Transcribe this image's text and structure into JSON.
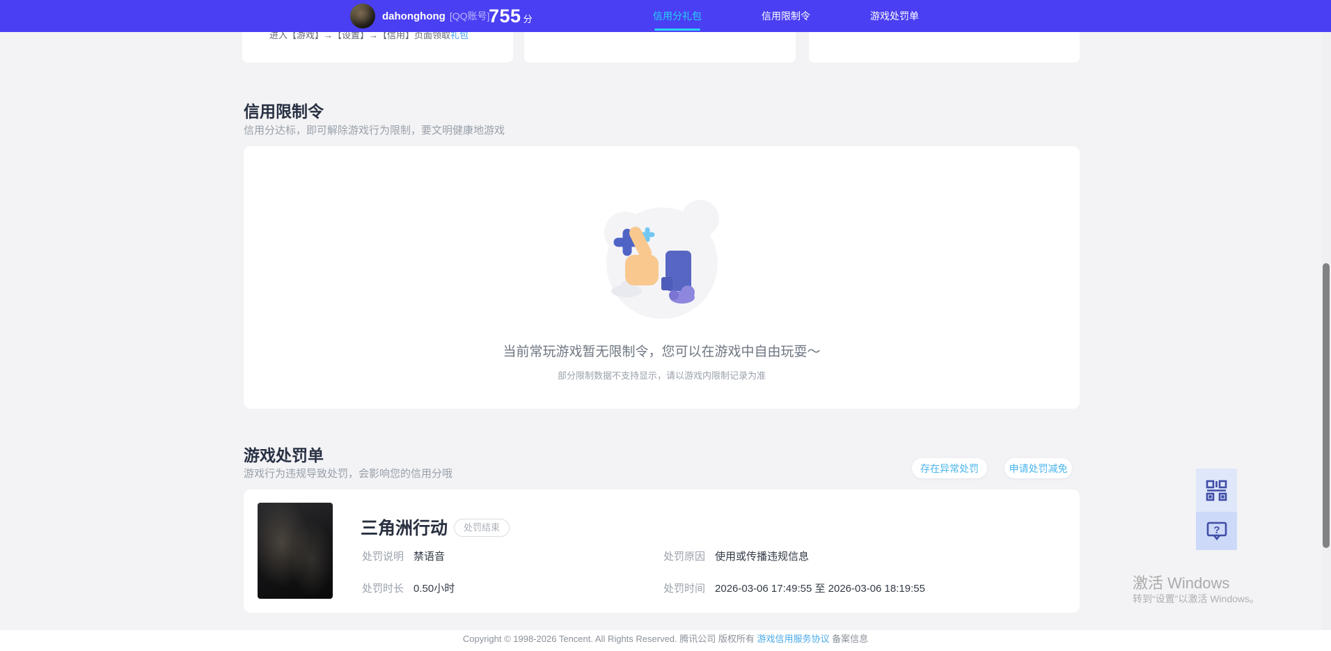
{
  "navbar": {
    "username": "dahonghong",
    "account_type": "[QQ账号]",
    "score": "755",
    "score_unit": "分",
    "tabs": [
      {
        "label": "信用分礼包",
        "active": true
      },
      {
        "label": "信用限制令",
        "active": false
      },
      {
        "label": "游戏处罚单",
        "active": false
      }
    ]
  },
  "gift_cards": {
    "clipped_hint_prefix": "进入【游戏】→【设置】→【信用】页面领取",
    "clipped_hint_link": "礼包"
  },
  "restriction_section": {
    "title": "信用限制令",
    "subtitle": "信用分达标，即可解除游戏行为限制，要文明健康地游戏",
    "empty_title": "当前常玩游戏暂无限制令，您可以在游戏中自由玩耍～",
    "empty_hint": "部分限制数据不支持显示，请以游戏内限制记录为准"
  },
  "penalty_section": {
    "title": "游戏处罚单",
    "subtitle": "游戏行为违规导致处罚，会影响您的信用分哦",
    "buttons": [
      {
        "label": "存在异常处罚"
      },
      {
        "label": "申请处罚减免"
      }
    ],
    "record": {
      "game": "三角洲行动",
      "status": "处罚结束",
      "fields": [
        {
          "label": "处罚说明",
          "value": "禁语音"
        },
        {
          "label": "处罚原因",
          "value": "使用或传播违规信息"
        },
        {
          "label": "处罚时长",
          "value": "0.50小时"
        },
        {
          "label": "处罚时间",
          "value": "2026-03-06 17:49:55 至 2026-03-06 18:19:55"
        }
      ]
    }
  },
  "floating_buttons": {
    "qr_icon": "qr-code-icon",
    "help_icon": "question-bubble-icon"
  },
  "watermark": {
    "line1": "激活 Windows",
    "line2": "转到“设置”以激活 Windows。"
  },
  "footer": {
    "prefix": "Copyright © 1998-2026 Tencent. All Rights Reserved. 腾讯公司 版权所有 ",
    "link": "游戏信用服务协议",
    "suffix": " 备案信息"
  },
  "colors": {
    "navbar_bg": "#4a3ff2",
    "active_tab_cyan": "#25d5f7",
    "pill_button_blue": "#4ab5ee",
    "heading_text": "#273042",
    "subtitle_gray": "#99a0a9",
    "page_bg": "#f3f3f5",
    "card_bg": "#ffffff"
  }
}
